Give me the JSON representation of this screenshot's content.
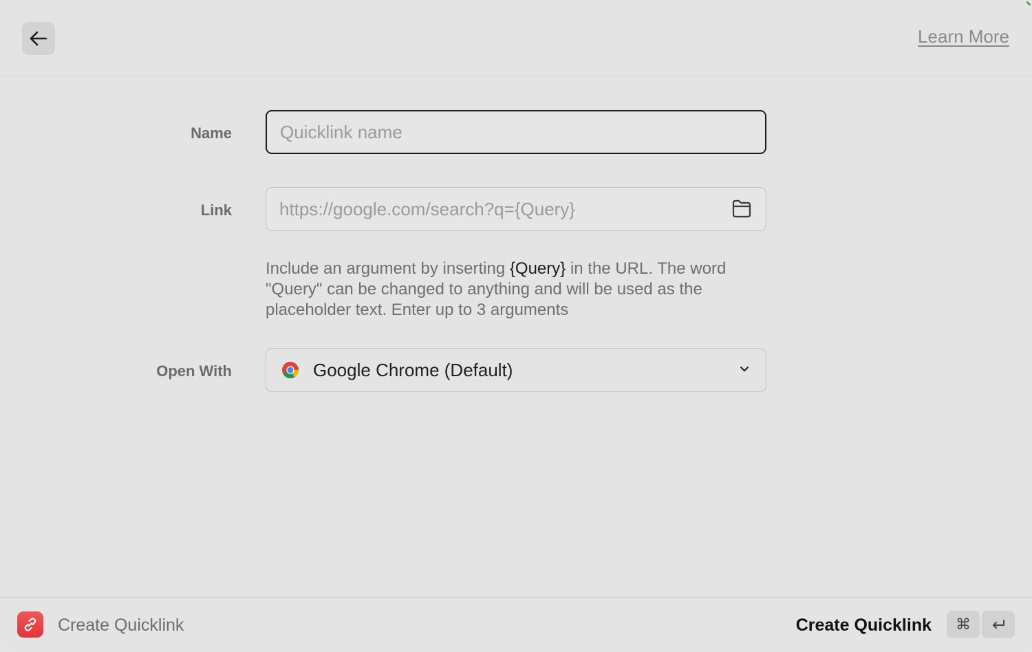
{
  "header": {
    "back_icon": "arrow-left-icon",
    "learn_more": "Learn More"
  },
  "form": {
    "name": {
      "label": "Name",
      "value": "",
      "placeholder": "Quicklink name"
    },
    "link": {
      "label": "Link",
      "value": "",
      "placeholder": "https://google.com/search?q={Query}",
      "icon": "folder-icon"
    },
    "help": {
      "before": "Include an argument by inserting ",
      "highlight": "{Query}",
      "after": " in the URL. The word \"Query\" can be changed to anything and will be used as the placeholder text. Enter up to 3 arguments"
    },
    "open_with": {
      "label": "Open With",
      "value": "Google Chrome (Default)",
      "icon": "chrome-icon"
    }
  },
  "footer": {
    "app_icon": "link-icon",
    "title": "Create Quicklink",
    "action": "Create Quicklink",
    "shortcut": [
      "⌘",
      "↵"
    ]
  },
  "colors": {
    "background": "#e4e4e4",
    "accent_red": "#e9454a",
    "text_primary": "#1e1e1e",
    "text_secondary": "#6e6e6e"
  }
}
